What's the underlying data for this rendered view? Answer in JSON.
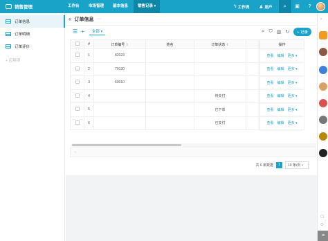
{
  "topbar": {
    "app_title": "销售管理",
    "nav": [
      "工作台",
      "市场管理",
      "基本信息",
      "销售记录"
    ],
    "nav_active_index": 3,
    "workbench_label": "工作流",
    "user_label": "用户"
  },
  "sidebar": {
    "items": [
      "订单信息",
      "订单明细",
      "订单评价"
    ],
    "active_index": 0,
    "add_label": "+ 应用项"
  },
  "page": {
    "title": "订单信息",
    "filter_label": "全部",
    "add_button": "+ 记录"
  },
  "table": {
    "headers": [
      "#",
      "订单编号",
      "姓名",
      "订单状态",
      "操作"
    ],
    "rows": [
      {
        "num": "1",
        "order_no": "82023",
        "name": "",
        "status": ""
      },
      {
        "num": "2",
        "order_no": "70130",
        "name": "",
        "status": ""
      },
      {
        "num": "3",
        "order_no": "60010",
        "name": "",
        "status": ""
      },
      {
        "num": "4",
        "order_no": "",
        "name": "",
        "status": "待支付"
      },
      {
        "num": "5",
        "order_no": "",
        "name": "",
        "status": "已下单"
      },
      {
        "num": "6",
        "order_no": "",
        "name": "",
        "status": "已支付"
      }
    ],
    "ops": [
      "查看",
      "编辑",
      "更多"
    ],
    "sum_label": "-"
  },
  "pager": {
    "total_text": "共 6 条数据",
    "current_page": "1",
    "page_size": "10 条/页"
  },
  "colors": {
    "accent": "#1aa3c9",
    "accent_dark": "#0d86a8"
  }
}
